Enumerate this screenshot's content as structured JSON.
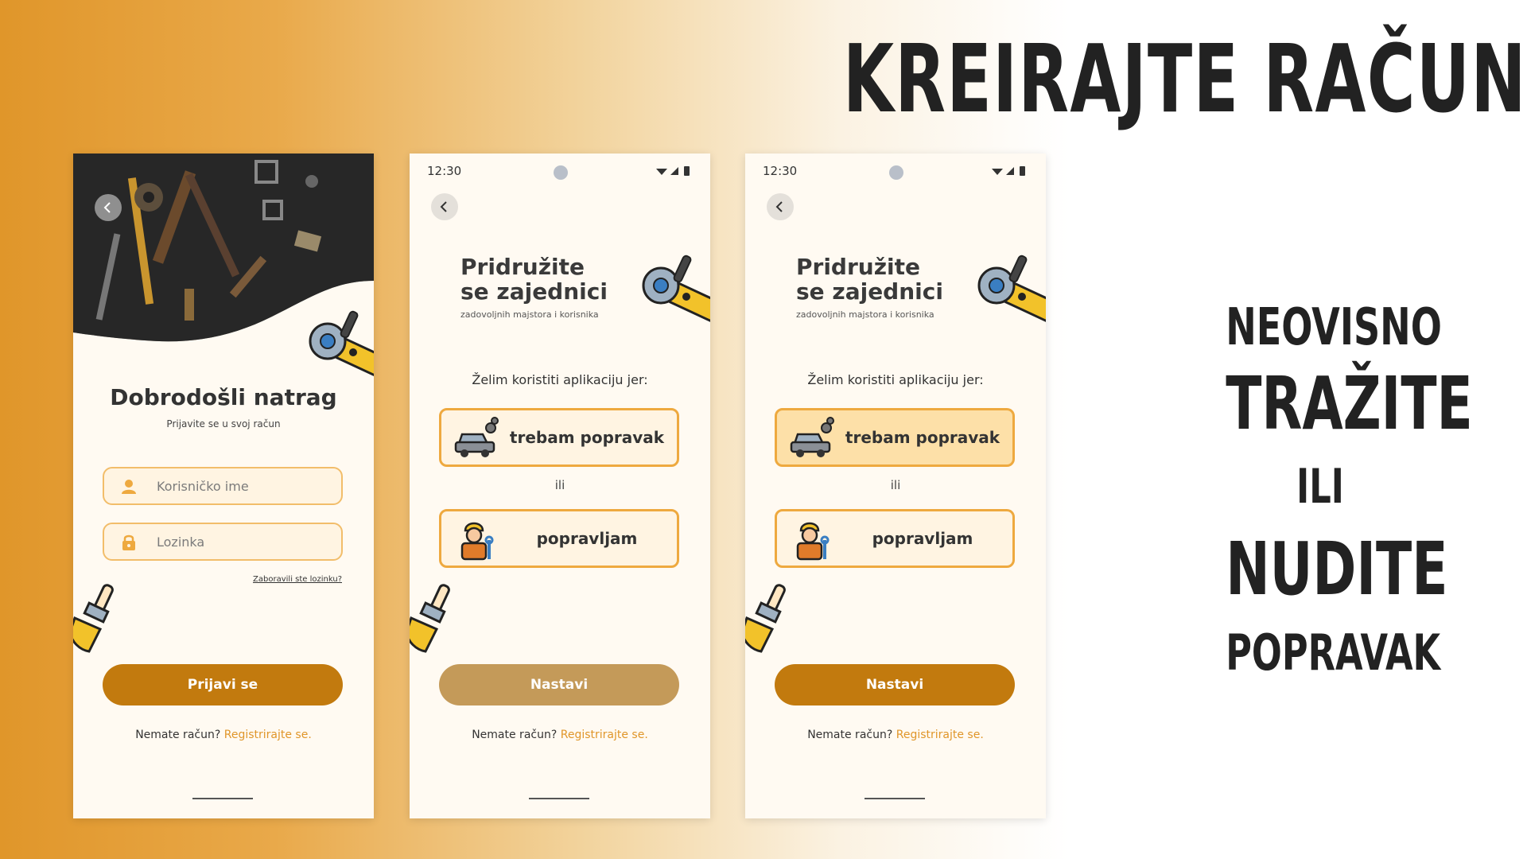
{
  "headline": "KREIRAJTE RAČUN",
  "side": {
    "line1": "NEOVISNO",
    "line2": "TRAŽITE",
    "line3": "ILI",
    "line4": "NUDITE",
    "line5": "POPRAVAK"
  },
  "login_screen": {
    "title": "Dobrodošli natrag",
    "subtitle": "Prijavite se u svoj račun",
    "username_placeholder": "Korisničko ime",
    "password_placeholder": "Lozinka",
    "forgot": "Zaboravili ste lozinku?",
    "login_button": "Prijavi se",
    "no_account": "Nemate račun?",
    "register": "Registrirajte se."
  },
  "join_screen": {
    "status_time": "12:30",
    "title_line1": "Pridružite",
    "title_line2": "se zajednici",
    "subtitle": "zadovoljnih majstora i korisnika",
    "why": "Želim koristiti aplikaciju jer:",
    "option1": "trebam popravak",
    "or": "ili",
    "option2": "popravljam",
    "continue_button": "Nastavi",
    "no_account": "Nemate račun?",
    "register": "Registrirajte se."
  },
  "colors": {
    "accent": "#c27a0e",
    "accent_faded": "#c49a59",
    "link": "#e0962a",
    "field_border": "#f2bd6a",
    "choice_border": "#eea93f",
    "choice_selected": "#fde0a8"
  },
  "selected_option": "option1"
}
